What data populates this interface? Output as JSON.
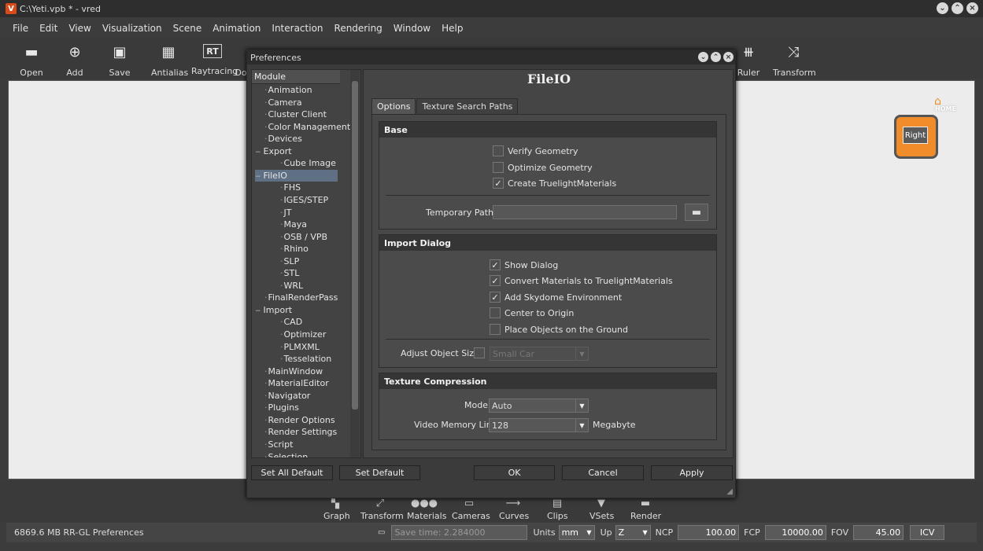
{
  "window": {
    "title": "C:\\Yeti.vpb * - vred"
  },
  "menu": [
    "File",
    "Edit",
    "View",
    "Visualization",
    "Scene",
    "Animation",
    "Interaction",
    "Rendering",
    "Window",
    "Help"
  ],
  "toolbar": {
    "open": "Open",
    "add": "Add",
    "save": "Save",
    "antialias": "Antialias",
    "raytracing": "Raytracing",
    "do": "Do",
    "ruler": "Ruler",
    "transform": "Transform",
    "rt_icon": "RT"
  },
  "viewport": {
    "cube_label": "Right",
    "home_label": "HOME"
  },
  "bottom_bar": [
    "Graph",
    "Transform",
    "Materials",
    "Cameras",
    "Curves",
    "Clips",
    "VSets",
    "Render"
  ],
  "status": {
    "memory": "6869.6 MB  RR-GL  Preferences",
    "save_time": "Save time: 2.284000",
    "units_label": "Units",
    "units_value": "mm",
    "up_label": "Up",
    "up_value": "Z",
    "ncp_label": "NCP",
    "ncp_value": "100.00",
    "fcp_label": "FCP",
    "fcp_value": "10000.00",
    "fov_label": "FOV",
    "fov_value": "45.00",
    "icv": "ICV"
  },
  "dialog": {
    "title": "Preferences",
    "tree_header": "Module",
    "tree": [
      {
        "label": "Animation",
        "level": 0
      },
      {
        "label": "Camera",
        "level": 0
      },
      {
        "label": "Cluster Client",
        "level": 0
      },
      {
        "label": "Color Management",
        "level": 0
      },
      {
        "label": "Devices",
        "level": 0
      },
      {
        "label": "Export",
        "level": 0,
        "expander": "−"
      },
      {
        "label": "Cube Image",
        "level": 1
      },
      {
        "label": "FileIO",
        "level": 0,
        "expander": "−",
        "selected": true
      },
      {
        "label": "FHS",
        "level": 1
      },
      {
        "label": "IGES/STEP",
        "level": 1
      },
      {
        "label": "JT",
        "level": 1
      },
      {
        "label": "Maya",
        "level": 1
      },
      {
        "label": "OSB / VPB",
        "level": 1
      },
      {
        "label": "Rhino",
        "level": 1
      },
      {
        "label": "SLP",
        "level": 1
      },
      {
        "label": "STL",
        "level": 1
      },
      {
        "label": "WRL",
        "level": 1
      },
      {
        "label": "FinalRenderPass",
        "level": 0
      },
      {
        "label": "Import",
        "level": 0,
        "expander": "−"
      },
      {
        "label": "CAD",
        "level": 1
      },
      {
        "label": "Optimizer",
        "level": 1
      },
      {
        "label": "PLMXML",
        "level": 1
      },
      {
        "label": "Tesselation",
        "level": 1
      },
      {
        "label": "MainWindow",
        "level": 0
      },
      {
        "label": "MaterialEditor",
        "level": 0
      },
      {
        "label": "Navigator",
        "level": 0
      },
      {
        "label": "Plugins",
        "level": 0
      },
      {
        "label": "Render Options",
        "level": 0
      },
      {
        "label": "Render Settings",
        "level": 0
      },
      {
        "label": "Script",
        "level": 0
      },
      {
        "label": "Selection",
        "level": 0
      }
    ],
    "panel_title": "FileIO",
    "tabs": [
      "Options",
      "Texture Search Paths"
    ],
    "base": {
      "title": "Base",
      "checks": [
        {
          "label": "Verify Geometry",
          "checked": false
        },
        {
          "label": "Optimize Geometry",
          "checked": false
        },
        {
          "label": "Create TruelightMaterials",
          "checked": true
        }
      ],
      "temp_path_label": "Temporary Path",
      "temp_path_value": ""
    },
    "import_dialog": {
      "title": "Import Dialog",
      "checks": [
        {
          "label": "Show Dialog",
          "checked": true
        },
        {
          "label": "Convert Materials to TruelightMaterials",
          "checked": true
        },
        {
          "label": "Add Skydome Environment",
          "checked": true
        },
        {
          "label": "Center to Origin",
          "checked": false
        },
        {
          "label": "Place Objects on the Ground",
          "checked": false
        }
      ],
      "adjust_label": "Adjust Object Size",
      "adjust_checked": false,
      "adjust_value": "Small Car"
    },
    "texture": {
      "title": "Texture Compression",
      "mode_label": "Mode",
      "mode_value": "Auto",
      "vml_label": "Video Memory Limit",
      "vml_value": "128",
      "vml_unit": "Megabyte"
    },
    "buttons": {
      "set_all_default": "Set All Default",
      "set_default": "Set Default",
      "ok": "OK",
      "cancel": "Cancel",
      "apply": "Apply"
    }
  },
  "colors": {
    "accent": "#f08d2a",
    "selection": "#5f6f84",
    "logo": "#d94a1a"
  }
}
